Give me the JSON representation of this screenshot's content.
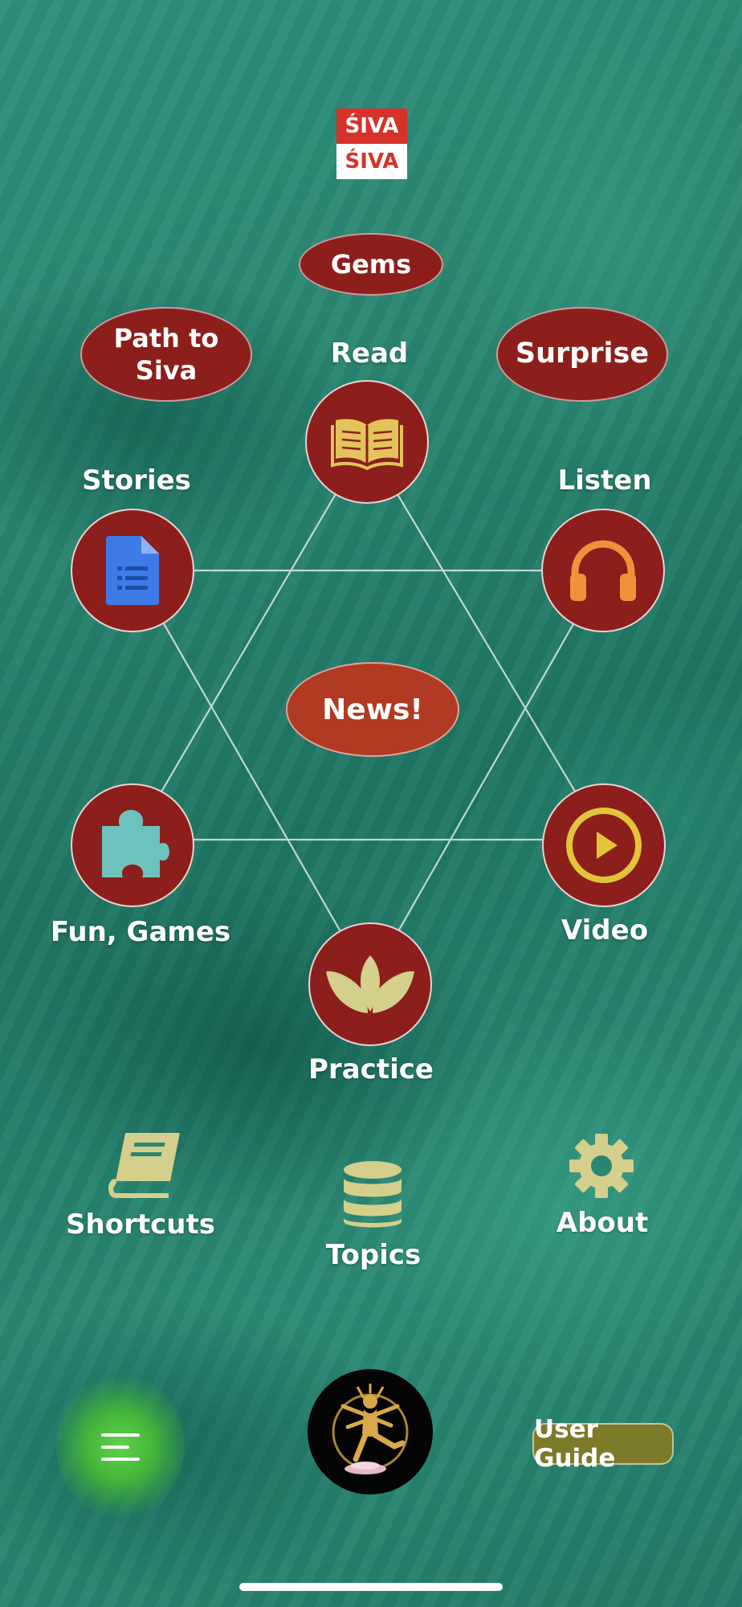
{
  "logo": {
    "line1": "ŚIVA",
    "line2": "ŚIVA"
  },
  "top_buttons": {
    "gems": "Gems",
    "path_line1": "Path to",
    "path_line2": "Siva",
    "surprise": "Surprise",
    "news": "News!"
  },
  "hexagram": {
    "read": "Read",
    "stories": "Stories",
    "listen": "Listen",
    "fun_games": "Fun, Games",
    "video": "Video",
    "practice": "Practice"
  },
  "bottom_nav": {
    "shortcuts": "Shortcuts",
    "topics": "Topics",
    "about": "About"
  },
  "footer": {
    "user_guide": "User Guide"
  },
  "icons": {
    "read": "open-book-icon",
    "stories": "document-icon",
    "listen": "headphones-icon",
    "fun_games": "puzzle-piece-icon",
    "video": "play-circle-icon",
    "practice": "lotus-icon",
    "shortcuts": "book-icon",
    "topics": "database-icon",
    "about": "gear-icon",
    "menu": "menu-icon"
  },
  "colors": {
    "button_red": "#8c1f1b",
    "news_red": "#b03a22",
    "icon_gold": "#e2c45a",
    "icon_tan": "#d4cf8a",
    "user_guide_olive": "#7d7a2a",
    "menu_green": "#5fd34a"
  }
}
